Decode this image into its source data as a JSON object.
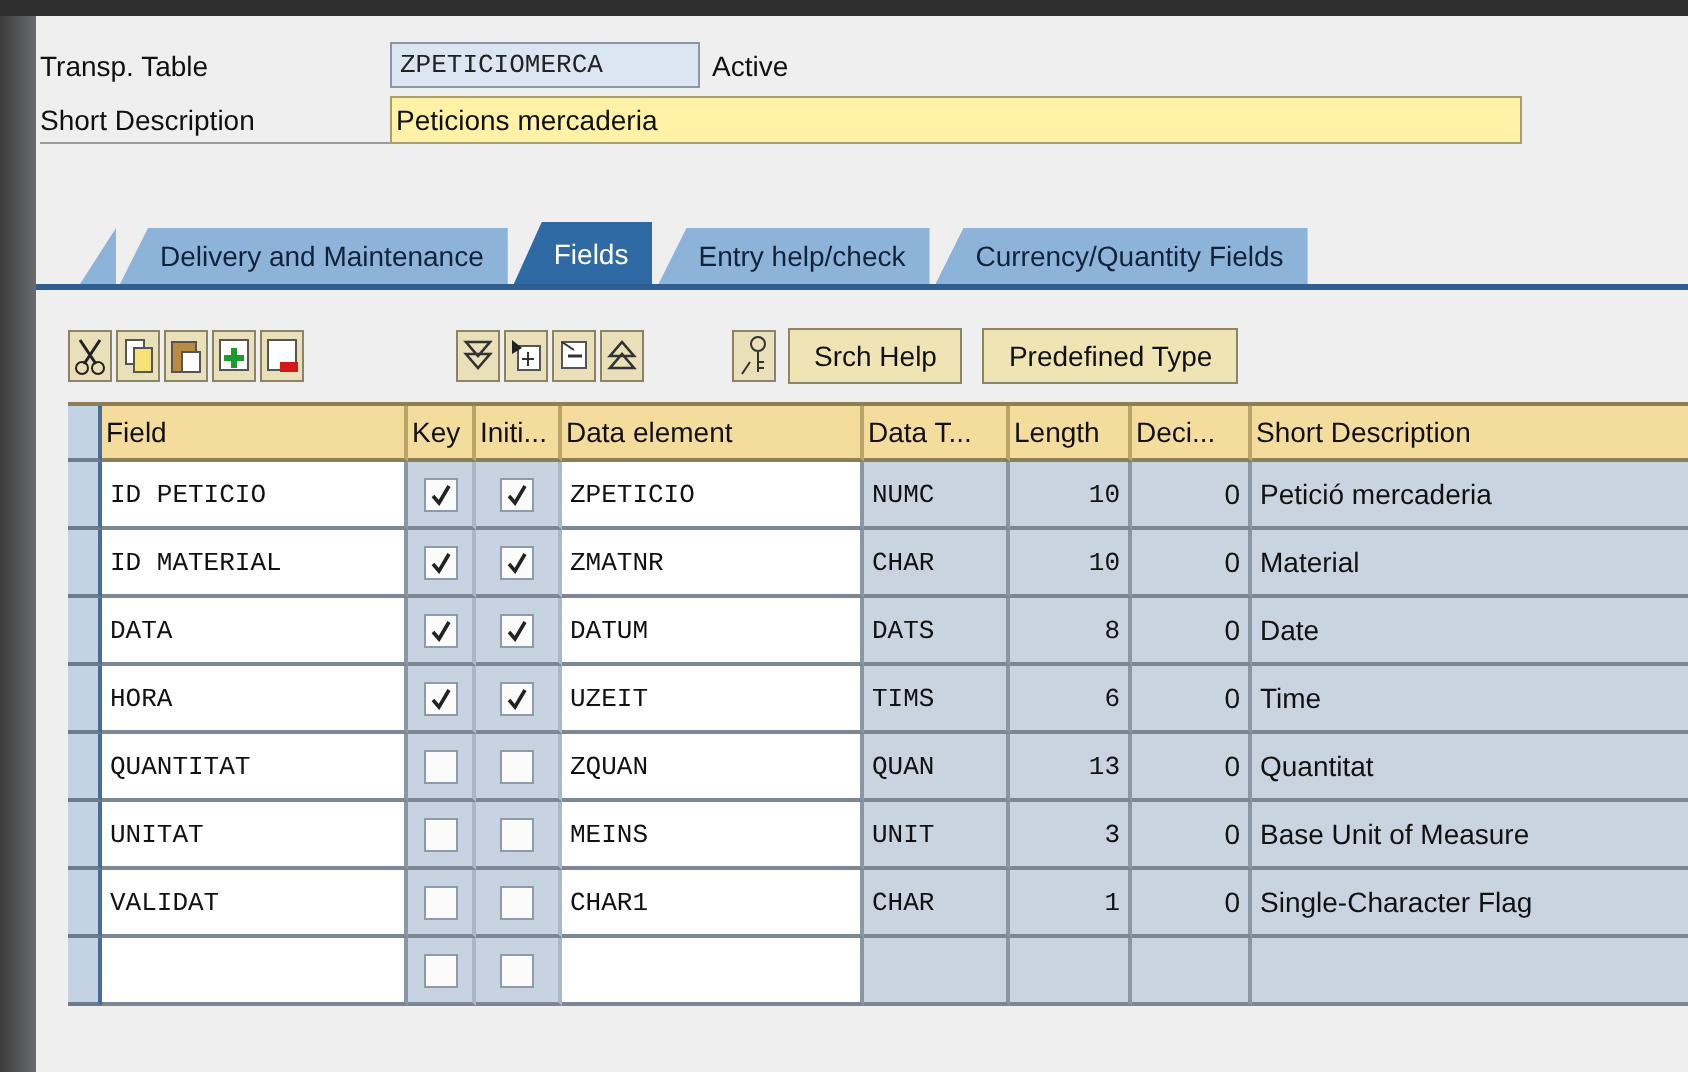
{
  "header": {
    "table_label": "Transp. Table",
    "table_name": "ZPETICIOMERCA",
    "status": "Active",
    "description_label": "Short Description",
    "description": "Peticions mercaderia"
  },
  "tabs": [
    {
      "label": "Delivery and Maintenance",
      "selected": false
    },
    {
      "label": "Fields",
      "selected": true
    },
    {
      "label": "Entry help/check",
      "selected": false
    },
    {
      "label": "Currency/Quantity Fields",
      "selected": false
    }
  ],
  "toolbar": {
    "buttons": [
      "Srch Help",
      "Predefined Type"
    ]
  },
  "table": {
    "columns": [
      "Field",
      "Key",
      "Initi...",
      "Data element",
      "Data T...",
      "Length",
      "Deci...",
      "Short Description"
    ],
    "rows": [
      {
        "field": "ID PETICIO",
        "key": true,
        "initial": true,
        "data_element": "ZPETICIO",
        "data_type": "NUMC",
        "length": "10",
        "decimals": "0",
        "description": "Petició mercaderia"
      },
      {
        "field": "ID MATERIAL",
        "key": true,
        "initial": true,
        "data_element": "ZMATNR",
        "data_type": "CHAR",
        "length": "10",
        "decimals": "0",
        "description": "Material"
      },
      {
        "field": "DATA",
        "key": true,
        "initial": true,
        "data_element": "DATUM",
        "data_type": "DATS",
        "length": "8",
        "decimals": "0",
        "description": "Date"
      },
      {
        "field": "HORA",
        "key": true,
        "initial": true,
        "data_element": "UZEIT",
        "data_type": "TIMS",
        "length": "6",
        "decimals": "0",
        "description": "Time"
      },
      {
        "field": "QUANTITAT",
        "key": false,
        "initial": false,
        "data_element": "ZQUAN",
        "data_type": "QUAN",
        "length": "13",
        "decimals": "0",
        "description": "Quantitat"
      },
      {
        "field": "UNITAT",
        "key": false,
        "initial": false,
        "data_element": "MEINS",
        "data_type": "UNIT",
        "length": "3",
        "decimals": "0",
        "description": "Base Unit of Measure"
      },
      {
        "field": "VALIDAT",
        "key": false,
        "initial": false,
        "data_element": "CHAR1",
        "data_type": "CHAR",
        "length": "1",
        "decimals": "0",
        "description": "Single-Character Flag"
      },
      {
        "key": false,
        "initial": false
      }
    ]
  }
}
